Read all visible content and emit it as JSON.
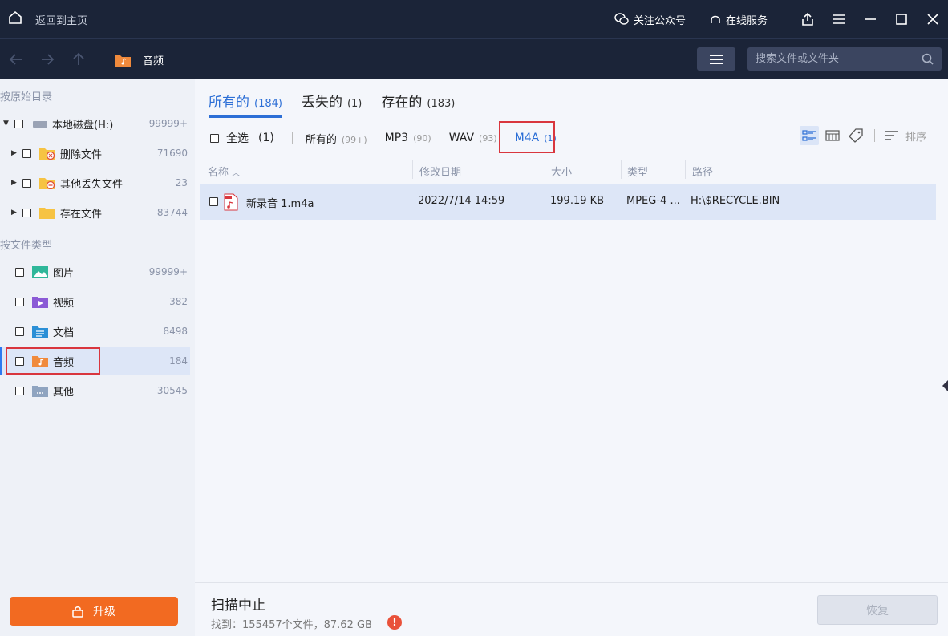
{
  "titlebar": {
    "back_home": "返回到主页",
    "follow": "关注公众号",
    "service": "在线服务"
  },
  "nav": {
    "crumb": "音频",
    "search_placeholder": "搜索文件或文件夹"
  },
  "sidebar": {
    "section_original": "按原始目录",
    "section_type": "按文件类型",
    "drive": {
      "label": "本地磁盘(H:)",
      "count": "99999+"
    },
    "dirs": [
      {
        "label": "删除文件",
        "count": "71690"
      },
      {
        "label": "其他丢失文件",
        "count": "23"
      },
      {
        "label": "存在文件",
        "count": "83744"
      }
    ],
    "types": [
      {
        "label": "图片",
        "count": "99999+",
        "icon": "image-folder-icon"
      },
      {
        "label": "视频",
        "count": "382",
        "icon": "video-folder-icon"
      },
      {
        "label": "文档",
        "count": "8498",
        "icon": "document-folder-icon"
      },
      {
        "label": "音频",
        "count": "184",
        "icon": "audio-folder-icon"
      },
      {
        "label": "其他",
        "count": "30545",
        "icon": "other-folder-icon"
      }
    ],
    "upgrade": "升级"
  },
  "tabs": [
    {
      "label": "所有的",
      "count": "(184)"
    },
    {
      "label": "丢失的",
      "count": "(1)"
    },
    {
      "label": "存在的",
      "count": "(183)"
    }
  ],
  "filters": {
    "select_all": "全选",
    "select_count": "(1)",
    "items": [
      {
        "label": "所有的",
        "count": "(99+)"
      },
      {
        "label": "MP3",
        "count": "(90)"
      },
      {
        "label": "WAV",
        "count": "(93)"
      },
      {
        "label": "M4A",
        "count": "(1)"
      }
    ],
    "sort": "排序"
  },
  "table": {
    "headers": [
      "名称",
      "修改日期",
      "大小",
      "类型",
      "路径"
    ],
    "rows": [
      {
        "name": "新录音 1.m4a",
        "date": "2022/7/14 14:59",
        "size": "199.19 KB",
        "type": "MPEG-4 ...",
        "path": "H:\\$RECYCLE.BIN"
      }
    ]
  },
  "status": {
    "title": "扫描中止",
    "found": "找到：155457个文件，87.62 GB",
    "recover": "恢复"
  },
  "colors": {
    "accent": "#2d6fd6",
    "upgrade": "#f26a21",
    "titlebar": "#1b2438",
    "highlight": "#d9363e"
  }
}
